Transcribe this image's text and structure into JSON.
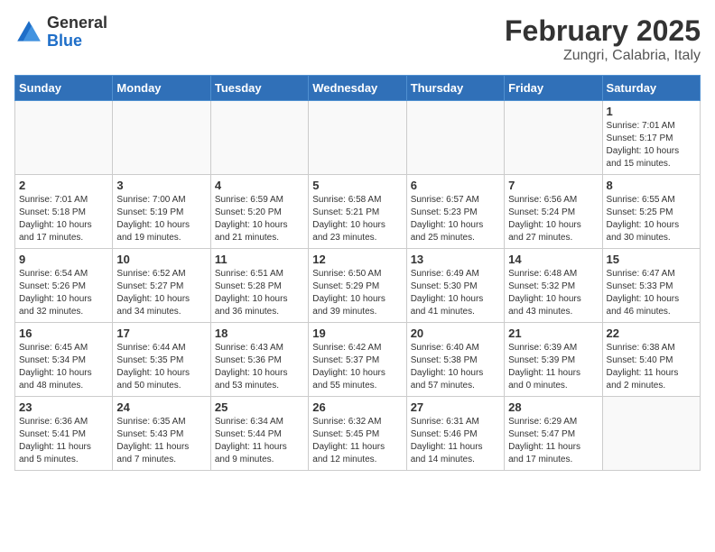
{
  "logo": {
    "general": "General",
    "blue": "Blue"
  },
  "title": {
    "month_year": "February 2025",
    "location": "Zungri, Calabria, Italy"
  },
  "weekdays": [
    "Sunday",
    "Monday",
    "Tuesday",
    "Wednesday",
    "Thursday",
    "Friday",
    "Saturday"
  ],
  "weeks": [
    [
      {
        "day": "",
        "info": ""
      },
      {
        "day": "",
        "info": ""
      },
      {
        "day": "",
        "info": ""
      },
      {
        "day": "",
        "info": ""
      },
      {
        "day": "",
        "info": ""
      },
      {
        "day": "",
        "info": ""
      },
      {
        "day": "1",
        "info": "Sunrise: 7:01 AM\nSunset: 5:17 PM\nDaylight: 10 hours\nand 15 minutes."
      }
    ],
    [
      {
        "day": "2",
        "info": "Sunrise: 7:01 AM\nSunset: 5:18 PM\nDaylight: 10 hours\nand 17 minutes."
      },
      {
        "day": "3",
        "info": "Sunrise: 7:00 AM\nSunset: 5:19 PM\nDaylight: 10 hours\nand 19 minutes."
      },
      {
        "day": "4",
        "info": "Sunrise: 6:59 AM\nSunset: 5:20 PM\nDaylight: 10 hours\nand 21 minutes."
      },
      {
        "day": "5",
        "info": "Sunrise: 6:58 AM\nSunset: 5:21 PM\nDaylight: 10 hours\nand 23 minutes."
      },
      {
        "day": "6",
        "info": "Sunrise: 6:57 AM\nSunset: 5:23 PM\nDaylight: 10 hours\nand 25 minutes."
      },
      {
        "day": "7",
        "info": "Sunrise: 6:56 AM\nSunset: 5:24 PM\nDaylight: 10 hours\nand 27 minutes."
      },
      {
        "day": "8",
        "info": "Sunrise: 6:55 AM\nSunset: 5:25 PM\nDaylight: 10 hours\nand 30 minutes."
      }
    ],
    [
      {
        "day": "9",
        "info": "Sunrise: 6:54 AM\nSunset: 5:26 PM\nDaylight: 10 hours\nand 32 minutes."
      },
      {
        "day": "10",
        "info": "Sunrise: 6:52 AM\nSunset: 5:27 PM\nDaylight: 10 hours\nand 34 minutes."
      },
      {
        "day": "11",
        "info": "Sunrise: 6:51 AM\nSunset: 5:28 PM\nDaylight: 10 hours\nand 36 minutes."
      },
      {
        "day": "12",
        "info": "Sunrise: 6:50 AM\nSunset: 5:29 PM\nDaylight: 10 hours\nand 39 minutes."
      },
      {
        "day": "13",
        "info": "Sunrise: 6:49 AM\nSunset: 5:30 PM\nDaylight: 10 hours\nand 41 minutes."
      },
      {
        "day": "14",
        "info": "Sunrise: 6:48 AM\nSunset: 5:32 PM\nDaylight: 10 hours\nand 43 minutes."
      },
      {
        "day": "15",
        "info": "Sunrise: 6:47 AM\nSunset: 5:33 PM\nDaylight: 10 hours\nand 46 minutes."
      }
    ],
    [
      {
        "day": "16",
        "info": "Sunrise: 6:45 AM\nSunset: 5:34 PM\nDaylight: 10 hours\nand 48 minutes."
      },
      {
        "day": "17",
        "info": "Sunrise: 6:44 AM\nSunset: 5:35 PM\nDaylight: 10 hours\nand 50 minutes."
      },
      {
        "day": "18",
        "info": "Sunrise: 6:43 AM\nSunset: 5:36 PM\nDaylight: 10 hours\nand 53 minutes."
      },
      {
        "day": "19",
        "info": "Sunrise: 6:42 AM\nSunset: 5:37 PM\nDaylight: 10 hours\nand 55 minutes."
      },
      {
        "day": "20",
        "info": "Sunrise: 6:40 AM\nSunset: 5:38 PM\nDaylight: 10 hours\nand 57 minutes."
      },
      {
        "day": "21",
        "info": "Sunrise: 6:39 AM\nSunset: 5:39 PM\nDaylight: 11 hours\nand 0 minutes."
      },
      {
        "day": "22",
        "info": "Sunrise: 6:38 AM\nSunset: 5:40 PM\nDaylight: 11 hours\nand 2 minutes."
      }
    ],
    [
      {
        "day": "23",
        "info": "Sunrise: 6:36 AM\nSunset: 5:41 PM\nDaylight: 11 hours\nand 5 minutes."
      },
      {
        "day": "24",
        "info": "Sunrise: 6:35 AM\nSunset: 5:43 PM\nDaylight: 11 hours\nand 7 minutes."
      },
      {
        "day": "25",
        "info": "Sunrise: 6:34 AM\nSunset: 5:44 PM\nDaylight: 11 hours\nand 9 minutes."
      },
      {
        "day": "26",
        "info": "Sunrise: 6:32 AM\nSunset: 5:45 PM\nDaylight: 11 hours\nand 12 minutes."
      },
      {
        "day": "27",
        "info": "Sunrise: 6:31 AM\nSunset: 5:46 PM\nDaylight: 11 hours\nand 14 minutes."
      },
      {
        "day": "28",
        "info": "Sunrise: 6:29 AM\nSunset: 5:47 PM\nDaylight: 11 hours\nand 17 minutes."
      },
      {
        "day": "",
        "info": ""
      }
    ]
  ]
}
